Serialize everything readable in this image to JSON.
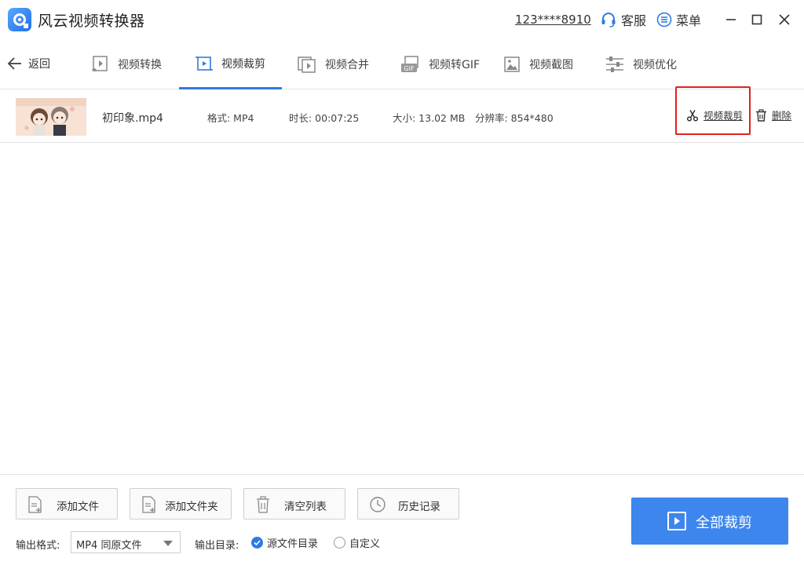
{
  "app": {
    "title": "风云视频转换器"
  },
  "header": {
    "account": "123****8910",
    "support_label": "客服",
    "menu_label": "菜单"
  },
  "nav": {
    "back_label": "返回",
    "tabs": [
      {
        "label": "视频转换",
        "icon": "video-convert-icon"
      },
      {
        "label": "视频裁剪",
        "icon": "video-crop-icon",
        "active": true
      },
      {
        "label": "视频合并",
        "icon": "video-merge-icon"
      },
      {
        "label": "视频转GIF",
        "icon": "gif-icon"
      },
      {
        "label": "视频截图",
        "icon": "screenshot-icon"
      },
      {
        "label": "视频优化",
        "icon": "optimize-icon"
      }
    ]
  },
  "files": [
    {
      "name": "初印象.mp4",
      "format": "格式: MP4",
      "duration": "时长: 00:07:25",
      "size": "大小: 13.02 MB",
      "resolution": "分辨率: 854*480",
      "crop_action": "视频裁剪",
      "delete_action": "删除"
    }
  ],
  "bottom": {
    "add_file": "添加文件",
    "add_folder": "添加文件夹",
    "clear_list": "清空列表",
    "history": "历史记录",
    "output_format_label": "输出格式:",
    "output_format_value": "MP4 同原文件",
    "output_dir_label": "输出目录:",
    "dir_source": "源文件目录",
    "dir_custom": "自定义",
    "selected_dir": "dir_source",
    "start_all": "全部裁剪"
  },
  "colors": {
    "accent": "#3d86ee",
    "tab_underline": "#2d7be5",
    "highlight_box": "#e02020"
  }
}
